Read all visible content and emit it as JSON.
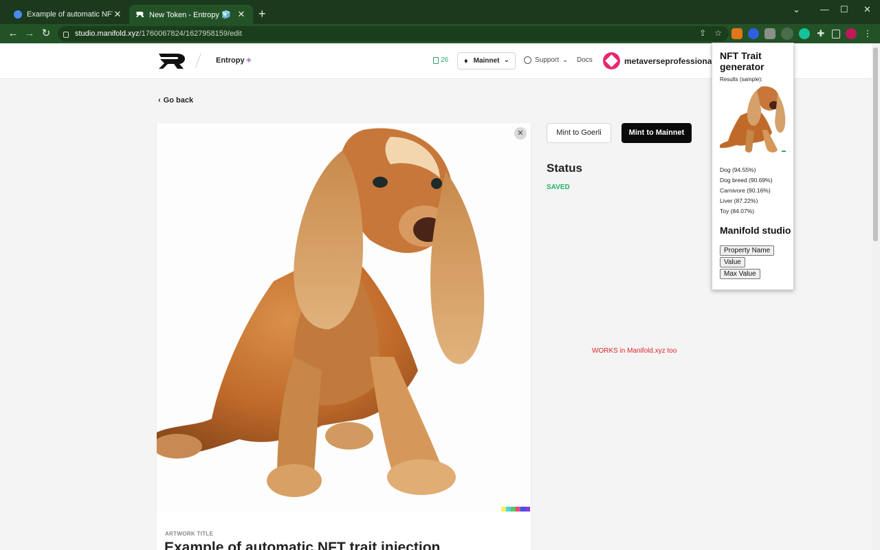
{
  "browser": {
    "tabs": [
      {
        "title": "Example of automatic NFT trait in",
        "close": "✕"
      },
      {
        "title": "New Token - Entropy 🧊",
        "close": "✕"
      }
    ],
    "new_tab": "+",
    "url_host": "studio.manifold.xyz",
    "url_path": "/1760067824/1627958159/edit",
    "window_controls": {
      "chevron": "⌄",
      "minimize": "—",
      "maximize": "☐",
      "close": "✕"
    }
  },
  "header": {
    "project_name": "Entropy",
    "gas": "26",
    "network": "Mainnet",
    "support": "Support",
    "docs": "Docs",
    "account": "metaverseprofessional.et"
  },
  "page": {
    "go_back": "Go back",
    "mint_goerli": "Mint to Goerli",
    "mint_mainnet": "Mint to Mainnet",
    "status_heading": "Status",
    "status_value": "SAVED",
    "note": "WORKS in Manifold.xyz too",
    "artwork_label": "ARTWORK TITLE",
    "artwork_title": "Example of automatic NFT trait injection"
  },
  "popup": {
    "title": "NFT Trait generator",
    "results_label": "Results (sample):",
    "results": [
      "Dog (94.55%)",
      "Dog breed (90.69%)",
      "Carnivore (90.16%)",
      "Liver (87.22%)",
      "Toy (84.07%)"
    ],
    "section2_title": "Manifold studio",
    "buttons": [
      "Property Name",
      "Value",
      "Max Value"
    ]
  },
  "colors": {
    "chrome_frame": "#1b3a1d",
    "chrome_toolbar": "#245227",
    "status_green": "#23b26b",
    "note_red": "#e0242a",
    "primary_button": "#0a0a0a"
  }
}
